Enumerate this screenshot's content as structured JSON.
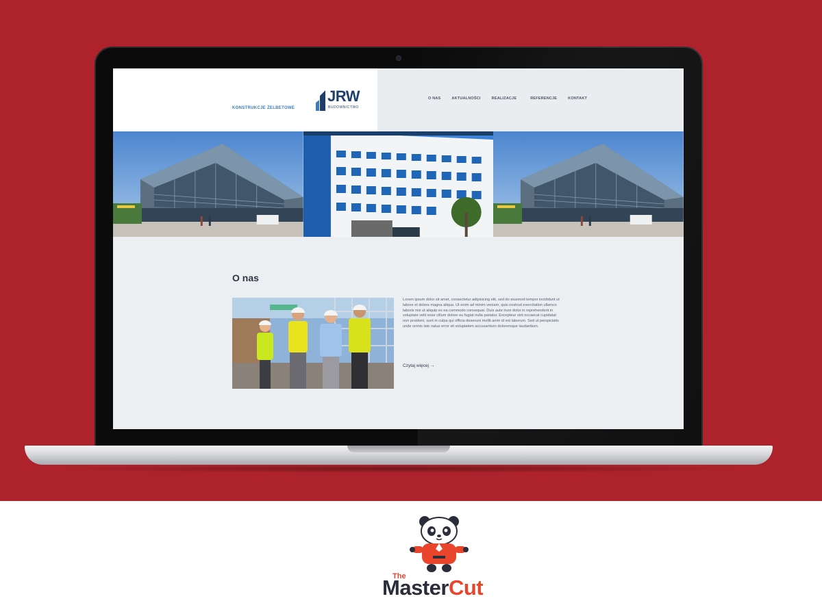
{
  "website": {
    "tagline": "KONSTRUKCJE ŻELBETOWE",
    "logo": {
      "name": "JRW",
      "subtitle": "BUDOWNICTWO"
    },
    "nav": [
      "O NAS",
      "AKTUALNOŚCI",
      "REALIZACJE",
      "REFERENCJE",
      "KONTAKT"
    ],
    "about": {
      "title": "O nas",
      "body": "Lorem ipsum dolor sit amet, consectetur adipisicing elit, sed do eiusmod tempor incididunt ut labore et dolore magna aliqua. Ut enim ad minim veniam, quis nostrud exercitation ullamco laboris nisi ut aliquip ex ea commodo consequat. Duis aute irure dolor in reprehenderit in voluptate velit esse cillum dolore eu fugiat nulla pariatur. Excepteur sint occaecat cupidatat non proident, sunt in culpa qui officia deserunt mollit anim id est laborum. Sed ut perspiciatis unde omnis iste natus error sit voluptatem accusantium doloremque laudantium.",
      "read_more": "Czytaj więcej →"
    }
  },
  "branding": {
    "the": "The",
    "master": "Master",
    "cut": "Cut"
  },
  "colors": {
    "background_red": "#ae232b",
    "logo_blue": "#1e3f6d",
    "accent_blue": "#3a79c4",
    "brand_orange": "#e8452c"
  }
}
